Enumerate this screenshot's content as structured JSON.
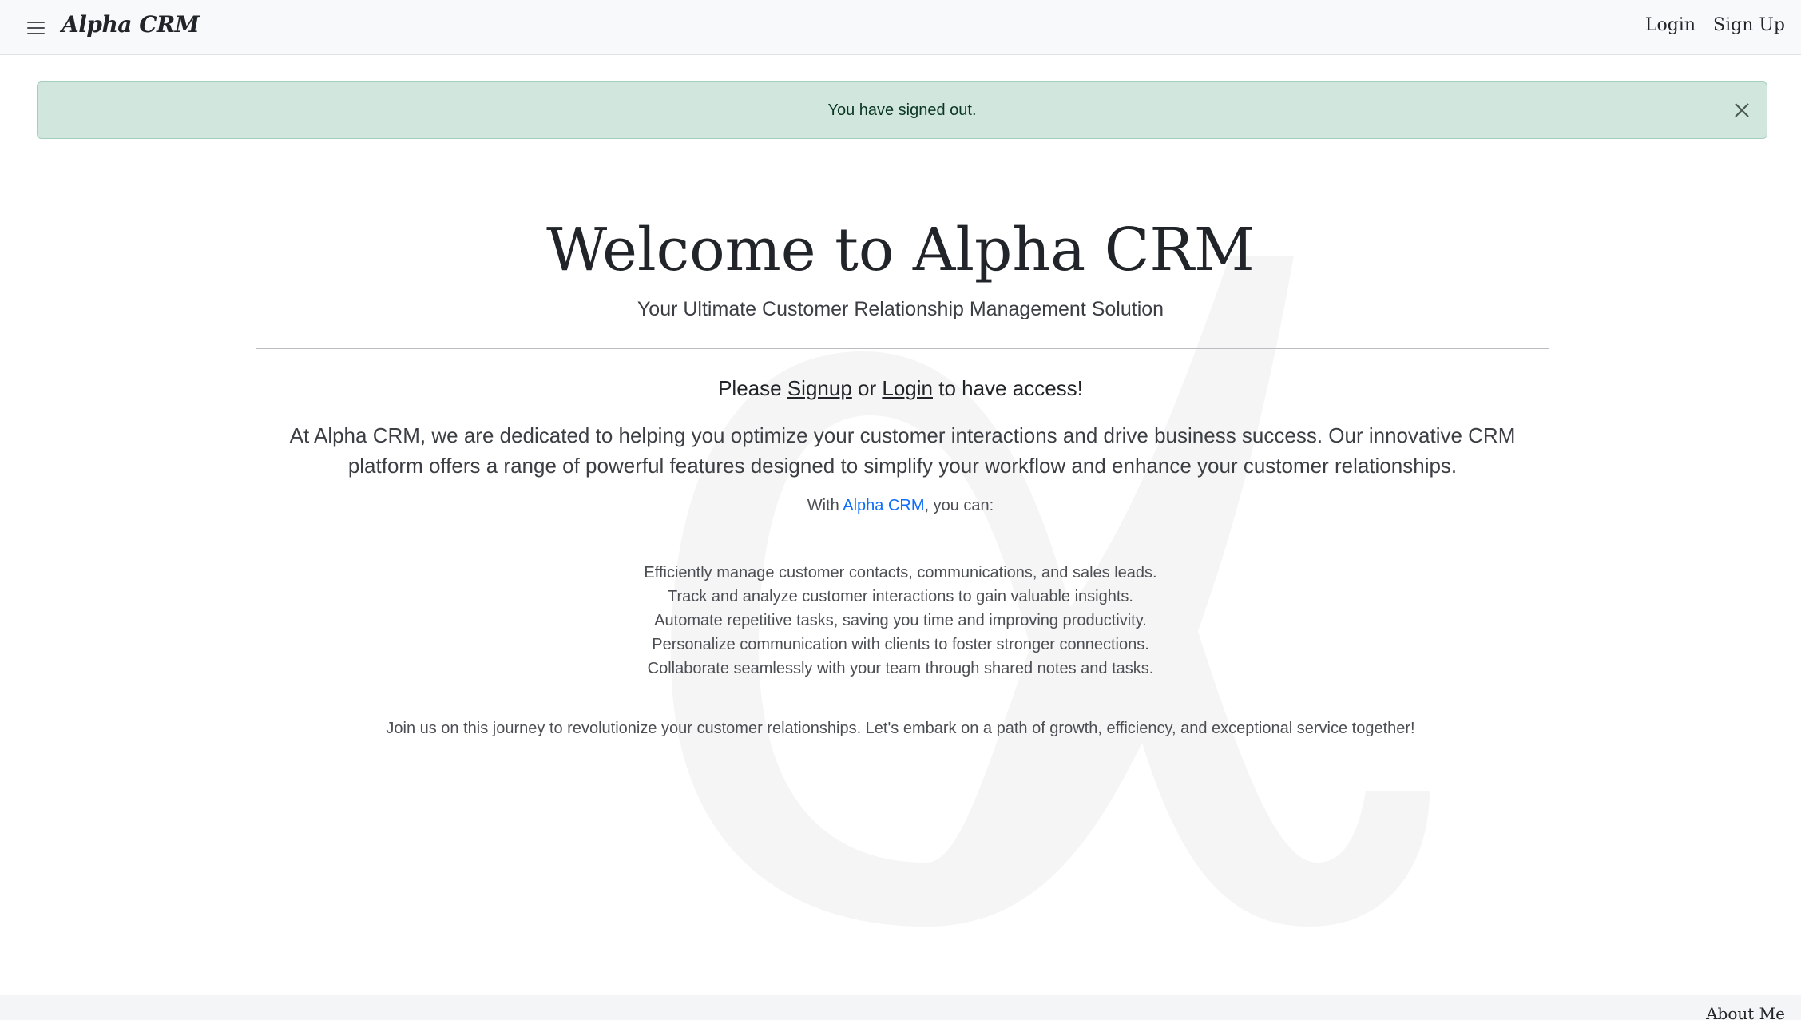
{
  "navbar": {
    "brand": "Alpha CRM",
    "links": [
      {
        "label": "Login"
      },
      {
        "label": "Sign Up"
      }
    ]
  },
  "alert": {
    "message": "You have signed out.",
    "type": "success"
  },
  "hero": {
    "title": "Welcome to Alpha CRM",
    "subtitle": "Your Ultimate Customer Relationship Management Solution"
  },
  "access": {
    "prefix": "Please ",
    "signup_link": "Signup",
    "middle": " or ",
    "login_link": "Login",
    "suffix": " to have access!"
  },
  "intro": "At Alpha CRM, we are dedicated to helping you optimize your customer interactions and drive business success. Our innovative CRM platform offers a range of powerful features designed to simplify your workflow and enhance your customer relationships.",
  "with_line": {
    "prefix": "With ",
    "link": "Alpha CRM",
    "suffix": ", you can:"
  },
  "features": [
    "Efficiently manage customer contacts, communications, and sales leads.",
    "Track and analyze customer interactions to gain valuable insights.",
    "Automate repetitive tasks, saving you time and improving productivity.",
    "Personalize communication with clients to foster stronger connections.",
    "Collaborate seamlessly with your team through shared notes and tasks."
  ],
  "closing": "Join us on this journey to revolutionize your customer relationships. Let's embark on a path of growth, efficiency, and exceptional service together!",
  "footer": {
    "link": "About Me"
  },
  "colors": {
    "navbar_bg": "#f8f9fa",
    "alert_bg": "#d1e7dd",
    "alert_text": "#0a3622",
    "link_blue": "#0d6efd"
  },
  "icons": {
    "menu": "hamburger-menu-icon",
    "close": "close-icon",
    "watermark": "alpha-symbol"
  }
}
